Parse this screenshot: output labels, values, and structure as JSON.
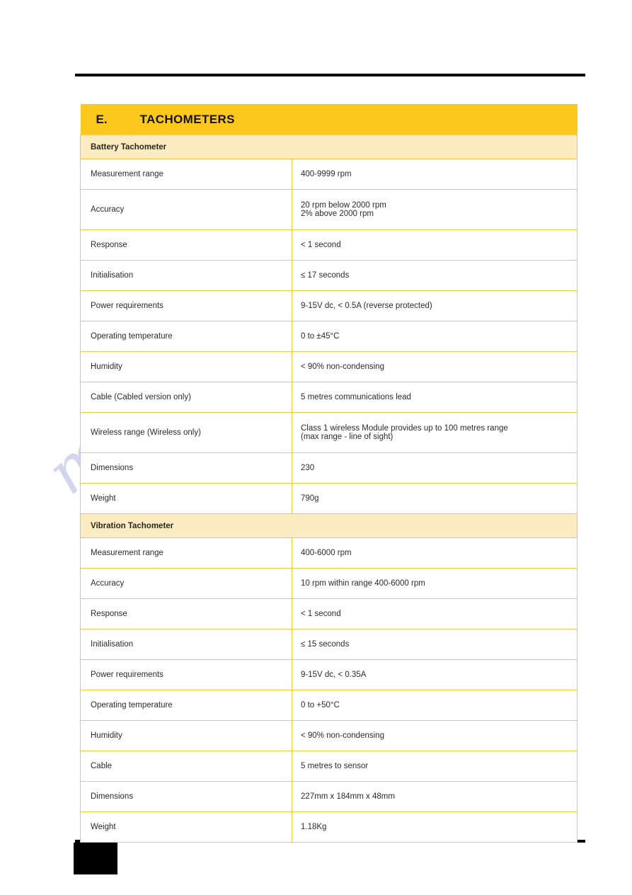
{
  "document": {
    "watermark": "manualshive.com",
    "colors": {
      "section_header_bg": "#FCC81E",
      "subsection_header_bg": "#FDECC2",
      "table_border": "#F6C93F",
      "rule": "#000000",
      "watermark": "#B9BCE4"
    }
  },
  "section": {
    "letter": "E.",
    "title": "TACHOMETERS"
  },
  "subsections": [
    {
      "heading": "Battery Tachometer",
      "rows": [
        {
          "label": "Measurement range",
          "value": "400-9999 rpm"
        },
        {
          "label": "Accuracy",
          "value": "20 rpm below 2000 rpm",
          "value2": "2% above 2000 rpm"
        },
        {
          "label": "Response",
          "value": "< 1 second"
        },
        {
          "label": "Initialisation",
          "value": "≤ 17 seconds"
        },
        {
          "label": "Power requirements",
          "value": "9-15V dc, < 0.5A (reverse protected)"
        },
        {
          "label": "Operating temperature",
          "value": "0 to ±45°C"
        },
        {
          "label": "Humidity",
          "value": "< 90% non-condensing"
        },
        {
          "label": "Cable (Cabled version only)",
          "value": "5 metres communications lead"
        },
        {
          "label": "Wireless range (Wireless only)",
          "value": "Class 1 wireless Module provides up to 100 metres range",
          "value2": "(max range - line of sight)"
        },
        {
          "label": "Dimensions",
          "value": "230"
        },
        {
          "label": "Weight",
          "value": "790g"
        }
      ]
    },
    {
      "heading": "Vibration Tachometer",
      "rows": [
        {
          "label": "Measurement range",
          "value": "400-6000 rpm"
        },
        {
          "label": "Accuracy",
          "value": "10 rpm within range 400-6000 rpm"
        },
        {
          "label": "Response",
          "value": "< 1 second"
        },
        {
          "label": "Initialisation",
          "value": "≤ 15 seconds"
        },
        {
          "label": "Power requirements",
          "value": "9-15V dc, < 0.35A"
        },
        {
          "label": "Operating temperature",
          "value": "0 to +50°C"
        },
        {
          "label": "Humidity",
          "value": "< 90% non-condensing"
        },
        {
          "label": "Cable",
          "value": "5 metres to sensor"
        },
        {
          "label": "Dimensions",
          "value": "227mm x 184mm x 48mm"
        },
        {
          "label": "Weight",
          "value": "1.18Kg"
        }
      ]
    }
  ]
}
